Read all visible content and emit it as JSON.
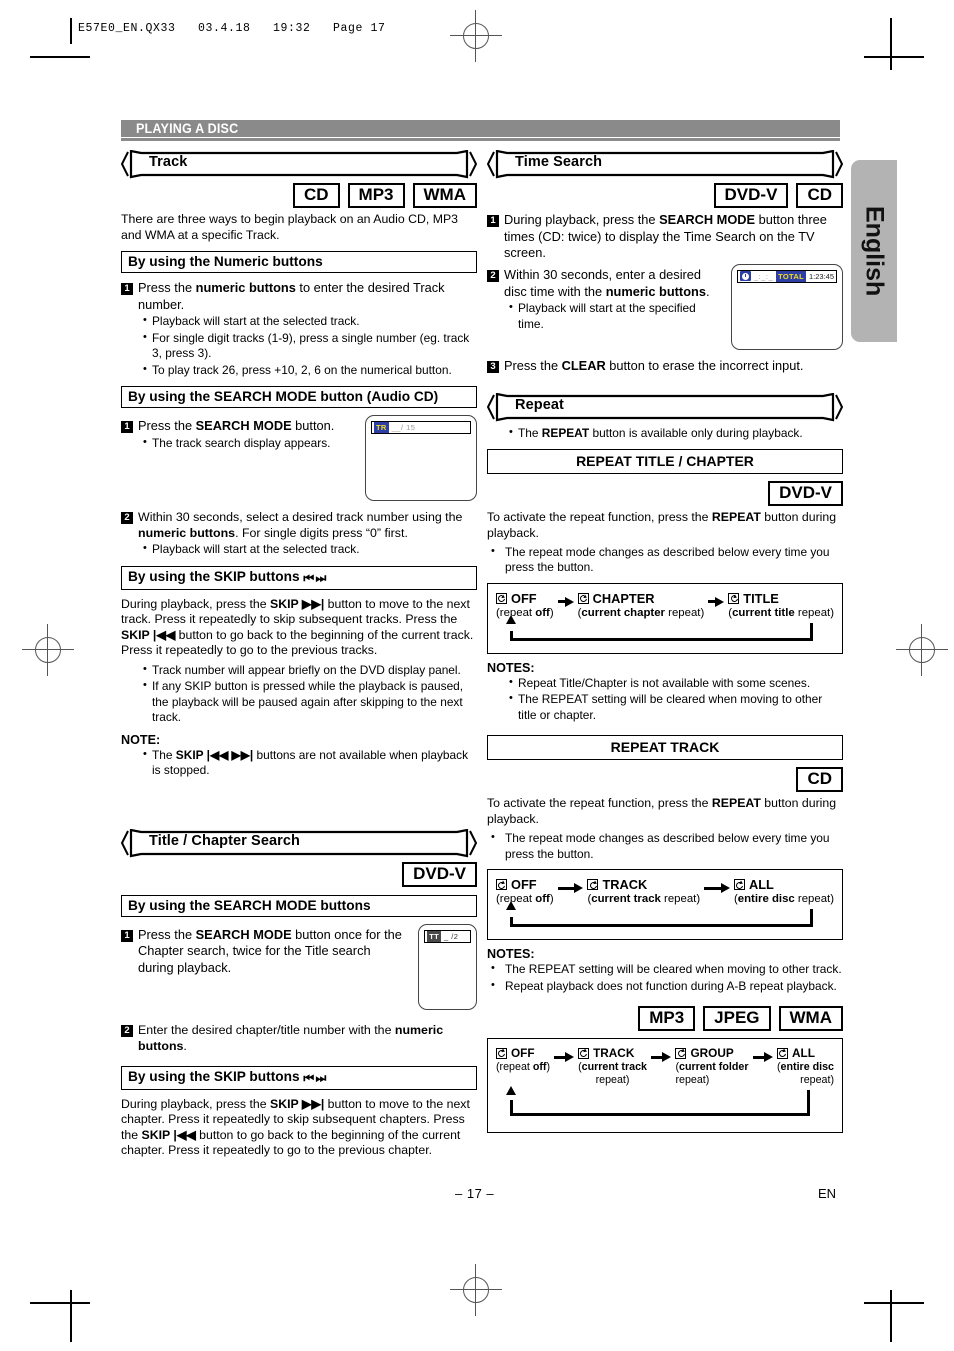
{
  "print_header": "E57E0_EN.QX33   03.4.18   19:32   Page 17",
  "lang_tab": "English",
  "section_bar": "PLAYING A DISC",
  "footer": {
    "page_number": "– 17 –",
    "lang_code": "EN"
  },
  "left_column": {
    "track": {
      "ribbon_title": "Track",
      "badges": [
        "CD",
        "MP3",
        "WMA"
      ],
      "intro": "There are three ways to begin playback on an Audio CD, MP3 and WMA at a specific Track.",
      "numeric": {
        "subhead": "By using the Numeric buttons",
        "step1_num": "1",
        "step1_pre": "Press the ",
        "step1_bold": "numeric buttons",
        "step1_post": " to enter the desired Track number.",
        "bullets": [
          "Playback will start at the selected track.",
          "For single digit tracks (1-9), press a single number (eg. track 3, press 3).",
          "To play track 26, press +10, 2, 6 on the numerical button."
        ]
      },
      "search_mode": {
        "subhead": "By using the SEARCH MODE button (Audio CD)",
        "step1_num": "1",
        "step1_pre": "Press the ",
        "step1_bold": "SEARCH MODE",
        "step1_post": " button.",
        "step1_bullet": "The track search display appears.",
        "osd": {
          "tag": "TR",
          "value": "__/ 15"
        },
        "step2_num": "2",
        "step2_a": "Within 30 seconds, select a desired track number using the ",
        "step2_bold": "numeric buttons",
        "step2_b": ".  For single digits press “0” first.",
        "step2_bullet": "Playback will start at the selected track."
      },
      "skip": {
        "subhead_pre": "By using the SKIP buttons",
        "subhead_icons": "⏮ ⏭",
        "para_1": "During playback, press the ",
        "para_b1": "SKIP ▶▶|",
        "para_2": " button to move to the next track.  Press it repeatedly to skip subsequent tracks.  Press the ",
        "para_b2": "SKIP |◀◀",
        "para_3": " button to go back to the beginning of the current track.  Press it repeatedly to go to the previous tracks.",
        "bullets": [
          "Track number will appear briefly on the DVD display panel.",
          "If any SKIP button is pressed while the playback is paused, the playback will be paused again after skipping to the next track."
        ],
        "note_head": "NOTE:",
        "note_pre": "The ",
        "note_bold": "SKIP |◀◀ ▶▶|",
        "note_post": " buttons are not available when playback is stopped."
      }
    },
    "title_chapter": {
      "ribbon_title": "Title / Chapter Search",
      "badges": [
        "DVD-V"
      ],
      "search_mode": {
        "subhead": "By using the SEARCH MODE buttons",
        "step1_num": "1",
        "step1_pre": "Press the ",
        "step1_bold": "SEARCH MODE",
        "step1_post": " button once for the Chapter search, twice for the Title search during playback.",
        "osd": {
          "tag": "TT",
          "value": "_ /2"
        },
        "step2_num": "2",
        "step2_a": "Enter the desired chapter/title number with the ",
        "step2_bold": "numeric buttons",
        "step2_b": "."
      },
      "skip": {
        "subhead_pre": "By using the SKIP buttons",
        "subhead_icons": "⏮ ⏭",
        "para_1": "During playback, press the ",
        "para_b1": "SKIP ▶▶|",
        "para_2": " button to move to the next chapter.  Press it repeatedly to skip subsequent chapters.  Press the ",
        "para_b2": "SKIP |◀◀",
        "para_3": " button to go back to the beginning of the current chapter.  Press it repeatedly to go to the previous chapter."
      }
    }
  },
  "right_column": {
    "time_search": {
      "ribbon_title": "Time Search",
      "badges": [
        "DVD-V",
        "CD"
      ],
      "step1_num": "1",
      "step1_pre": "During playback, press the ",
      "step1_bold": "SEARCH MODE",
      "step1_post": " button three times (CD: twice) to display the Time Search on the TV screen.",
      "step2_num": "2",
      "step2_pre": "Within 30 seconds, enter a desired disc time with the ",
      "step2_bold": "numeric buttons",
      "step2_post": ".",
      "step2_bullet": "Playback will start at the specified time.",
      "osd": {
        "icon": "clock-icon",
        "value": "_:_:_",
        "total_label": "TOTAL",
        "total_value": "1:23:45"
      },
      "step3_num": "3",
      "step3_pre": "Press the ",
      "step3_bold": "CLEAR",
      "step3_post": " button to erase the incorrect input."
    },
    "repeat": {
      "ribbon_title": "Repeat",
      "lead_pre": "The ",
      "lead_bold": "REPEAT",
      "lead_post": " button is available only during playback.",
      "title_chapter": {
        "subhead": "REPEAT TITLE / CHAPTER",
        "badges": [
          "DVD-V"
        ],
        "para_a": "To activate the repeat function, press the ",
        "para_bold": "REPEAT",
        "para_b": " button during playback.",
        "bullet": "The repeat mode changes as described below every time you press the button.",
        "flow": [
          {
            "label": "OFF",
            "sub_a": "(repeat ",
            "sub_bold": "off",
            "sub_b": ")"
          },
          {
            "label": "CHAPTER",
            "sub_a": "(",
            "sub_bold": "current chapter",
            "sub_b": " repeat)"
          },
          {
            "label": "TITLE",
            "sub_a": "(",
            "sub_bold": "current title",
            "sub_b": " repeat)"
          }
        ],
        "notes_head": "NOTES:",
        "notes": [
          "Repeat Title/Chapter is not available with some scenes.",
          "The REPEAT setting will be cleared when moving to other title or chapter."
        ]
      },
      "track": {
        "subhead": "REPEAT TRACK",
        "badges": [
          "CD"
        ],
        "para_a": "To activate the repeat function, press the ",
        "para_bold": "REPEAT",
        "para_b": " button during playback.",
        "bullet": "The repeat mode changes as described below every time you press the button.",
        "flow": [
          {
            "label": "OFF",
            "sub_a": "(repeat ",
            "sub_bold": "off",
            "sub_b": ")"
          },
          {
            "label": "TRACK",
            "sub_a": "(",
            "sub_bold": "current track",
            "sub_b": " repeat)"
          },
          {
            "label": "ALL",
            "sub_a": "(",
            "sub_bold": "entire disc",
            "sub_b": " repeat)"
          }
        ],
        "notes_head": "NOTES:",
        "notes": [
          "The REPEAT setting will be cleared when moving to other track.",
          "Repeat playback does not function during A-B repeat playback."
        ]
      },
      "media": {
        "badges": [
          "MP3",
          "JPEG",
          "WMA"
        ],
        "flow": [
          {
            "label": "OFF",
            "sub_a": "(repeat ",
            "sub_bold": "off",
            "sub_b": ")",
            "sub2": ""
          },
          {
            "label": "TRACK",
            "sub_a": "(",
            "sub_bold": "current track",
            "sub_b": "",
            "sub2": "repeat)"
          },
          {
            "label": "GROUP",
            "sub_a": "(",
            "sub_bold": "current folder",
            "sub_b": "",
            "sub2": "repeat)"
          },
          {
            "label": "ALL",
            "sub_a": "(",
            "sub_bold": "entire disc",
            "sub_b": "",
            "sub2": "repeat)"
          }
        ]
      }
    }
  }
}
